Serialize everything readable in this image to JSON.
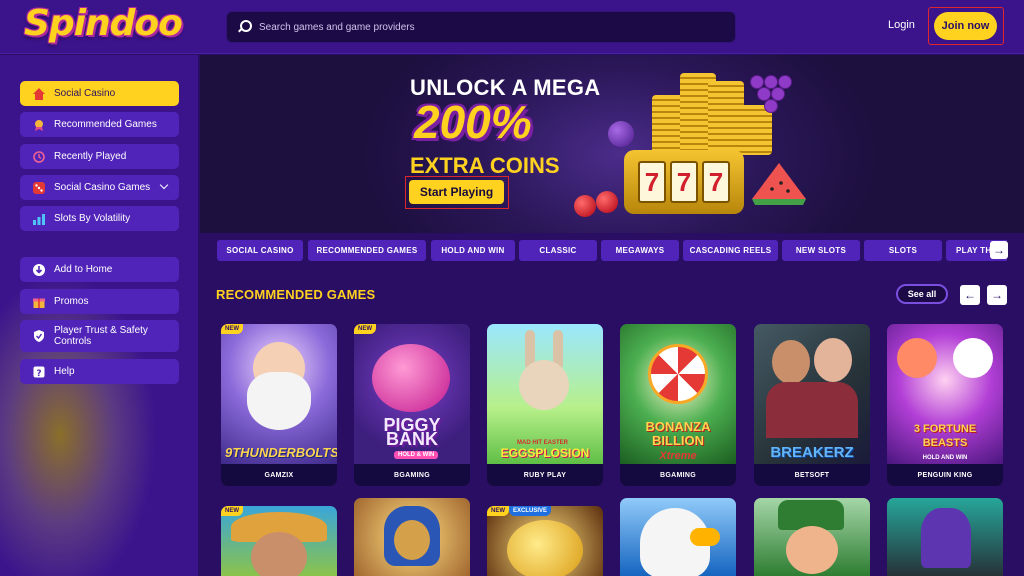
{
  "header": {
    "logo": "Spindoo",
    "search_placeholder": "Search games and game providers",
    "login_label": "Login",
    "join_label": "Join now"
  },
  "sidebar": {
    "items": [
      {
        "label": "Social Casino",
        "icon": "home-icon"
      },
      {
        "label": "Recommended Games",
        "icon": "award-icon"
      },
      {
        "label": "Recently Played",
        "icon": "history-icon"
      },
      {
        "label": "Social Casino Games",
        "icon": "dice-icon"
      },
      {
        "label": "Slots By Volatility",
        "icon": "chart-icon"
      }
    ],
    "items2": [
      {
        "label": "Add to Home",
        "icon": "download-icon"
      },
      {
        "label": "Promos",
        "icon": "gift-icon"
      },
      {
        "label": "Player Trust & Safety Controls",
        "icon": "shield-icon"
      },
      {
        "label": "Help",
        "icon": "help-icon"
      }
    ]
  },
  "banner": {
    "line1": "UNLOCK A MEGA",
    "line2": "200%",
    "line3": "EXTRA COINS",
    "cta": "Start Playing",
    "reels": [
      "7",
      "7",
      "7"
    ]
  },
  "categories": [
    "SOCIAL CASINO",
    "RECOMMENDED GAMES",
    "HOLD AND WIN",
    "CLASSIC",
    "MEGAWAYS",
    "CASCADING REELS",
    "NEW SLOTS",
    "SLOTS",
    "PLAY TH"
  ],
  "section": {
    "title": "RECOMMENDED GAMES",
    "see_all": "See all"
  },
  "games": [
    {
      "name": "9THUNDERBOLTS",
      "provider": "GAMZIX",
      "badge": "NEW"
    },
    {
      "name": "PIGGY BANK",
      "sub": "HOLD & WIN",
      "provider": "BGAMING",
      "badge": "NEW"
    },
    {
      "name": "EGGSPLOSION",
      "sub": "MAD HIT EASTER",
      "provider": "RUBY PLAY",
      "badge": ""
    },
    {
      "name": "BONANZA BILLION",
      "sub": "Xtreme",
      "provider": "BGAMING",
      "badge": ""
    },
    {
      "name": "BREAKERZ",
      "provider": "BETSOFT",
      "badge": ""
    },
    {
      "name": "3 FORTUNE BEASTS",
      "sub": "HOLD AND WIN",
      "provider": "PENGUIN KING",
      "badge": ""
    }
  ],
  "games_row2": [
    {
      "badge": "NEW"
    },
    {
      "badge": ""
    },
    {
      "badge": "NEW",
      "badge2": "EXCLUSIVE"
    },
    {
      "badge": ""
    },
    {
      "badge": ""
    },
    {
      "badge": ""
    }
  ],
  "colors": {
    "accent": "#ffd21f",
    "bg": "#2a0e63",
    "nav": "#5024b8",
    "header": "#3b148c"
  }
}
